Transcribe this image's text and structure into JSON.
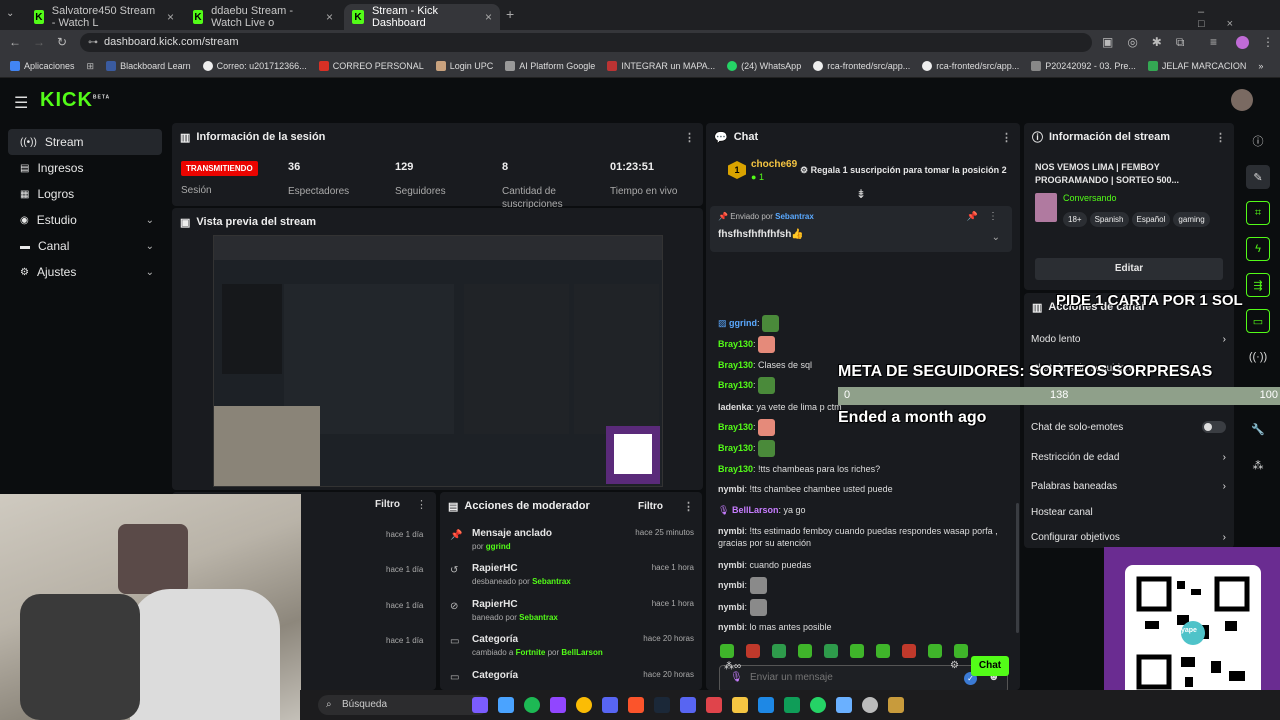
{
  "browser": {
    "tabs": [
      {
        "title": "Salvatore450 Stream - Watch L"
      },
      {
        "title": "ddaebu Stream - Watch Live o"
      },
      {
        "title": "Stream - Kick Dashboard"
      }
    ],
    "url": "dashboard.kick.com/stream",
    "bookmarks": [
      "Aplicaciones",
      "Blackboard Learn",
      "Correo: u201712366...",
      "CORREO PERSONAL",
      "Login UPC",
      "AI Platform Google",
      "INTEGRAR un MAPA...",
      "(24) WhatsApp",
      "rca-fronted/src/app...",
      "rca-fronted/src/app...",
      "P20242092 - 03. Pre...",
      "JELAF MARCACION"
    ]
  },
  "app": {
    "logo": "KICK",
    "logo_beta": "BETA",
    "nav": [
      {
        "label": "Stream",
        "icon": "stream-icon"
      },
      {
        "label": "Ingresos",
        "icon": "revenue-icon"
      },
      {
        "label": "Logros",
        "icon": "achievements-icon"
      },
      {
        "label": "Estudio",
        "icon": "studio-icon"
      },
      {
        "label": "Canal",
        "icon": "channel-icon"
      },
      {
        "label": "Ajustes",
        "icon": "settings-icon"
      }
    ],
    "session": {
      "title": "Información de la sesión",
      "status": "TRANSMITIENDO",
      "status_label": "Sesión",
      "viewers": "36",
      "viewers_label": "Espectadores",
      "followers": "129",
      "followers_label": "Seguidores",
      "subs": "8",
      "subs_label": "Cantidad de suscripciones",
      "time": "01:23:51",
      "time_label": "Tiempo en vivo"
    },
    "preview": {
      "title": "Vista previa del stream"
    },
    "left_panel": {
      "filter": "Filtro",
      "times": [
        "hace 1 día",
        "hace 1 día",
        "hace 1 día",
        "hace 1 día"
      ]
    },
    "mod_actions": {
      "title": "Acciones de moderador",
      "filter": "Filtro",
      "rows": [
        {
          "title": "Mensaje anclado",
          "sub_pre": "por",
          "user": "ggrind",
          "time": "hace 25 minutos",
          "icon": "pin-icon"
        },
        {
          "title": "RapierHC",
          "sub_pre": "desbaneado por",
          "user": "Sebantrax",
          "time": "hace 1 hora",
          "icon": "unban-icon"
        },
        {
          "title": "RapierHC",
          "sub_pre": "baneado por",
          "user": "Sebantrax",
          "time": "hace 1 hora",
          "icon": "ban-icon"
        },
        {
          "title": "Categoría",
          "sub_pre": "cambiado a",
          "target": "Fortnite",
          "sub_mid": "por",
          "user": "BellLarson",
          "time": "hace 20 horas",
          "icon": "category-icon"
        },
        {
          "title": "Categoría",
          "time": "hace 20 horas",
          "icon": "category-icon"
        }
      ]
    },
    "chat": {
      "title": "Chat",
      "gift_user": "choche69",
      "gift_count": "1",
      "gift_rank": "1",
      "gift_text": "Regala 1 suscripción para tomar la posición 2",
      "pinned_by_label": "Enviado por",
      "pinned_by": "Sebantrax",
      "pinned_text": "fhsfhsfhfhfhfsh👍",
      "messages": [
        {
          "user": "ggrind",
          "text": ":",
          "color": "#5aa9ff"
        },
        {
          "user": "Bray130",
          "text": ":",
          "color": "#53fc18"
        },
        {
          "user": "Bray130",
          "text": ": Clases de sql",
          "color": "#53fc18"
        },
        {
          "user": "Bray130",
          "text": ":",
          "color": "#53fc18"
        },
        {
          "user": "ladenka",
          "text": ": ya vete de lima p ctm",
          "color": "#ddd"
        },
        {
          "user": "Bray130",
          "text": ":",
          "color": "#53fc18"
        },
        {
          "user": "Bray130",
          "text": ":",
          "color": "#53fc18"
        },
        {
          "user": "Bray130",
          "text": ": !tts chambeas para los riches?",
          "color": "#53fc18"
        },
        {
          "user": "nymbi",
          "text": ": !tts chambee chambee usted puede",
          "color": "#ddd"
        },
        {
          "user": "BellLarson",
          "text": ": ya go",
          "color": "#c77dff"
        },
        {
          "user": "nymbi",
          "text": ": !tts estimado femboy cuando puedas respondes wasap porfa , gracias por su atención",
          "color": "#ddd"
        },
        {
          "user": "nymbi",
          "text": ": cuando puedas",
          "color": "#ddd"
        },
        {
          "user": "nymbi",
          "text": ":",
          "color": "#ddd"
        },
        {
          "user": "nymbi",
          "text": ":",
          "color": "#ddd"
        },
        {
          "user": "nymbi",
          "text": ": lo mas antes posible",
          "color": "#ddd"
        }
      ],
      "input_placeholder": "Enviar un mensaje",
      "send": "Chat"
    },
    "stream_info": {
      "title": "Información del stream",
      "stream_title": "NOS VEMOS LIMA | FEMBOY PROGRAMANDO | SORTEO 500...",
      "category": "Conversando",
      "tags": [
        "18+",
        "Spanish",
        "Español",
        "gaming"
      ],
      "edit": "Editar"
    },
    "chat_actions": {
      "title": "Acciones de canal",
      "items": [
        "Modo lento",
        "Chat de solo-seguidores",
        "",
        "Chat de solo-emotes",
        "Restricción de edad",
        "Palabras baneadas",
        "Hostear canal",
        "Configurar objetivos"
      ]
    },
    "overlay": {
      "ticker": "PIDE 1 CARTA POR 1 SOL",
      "goal_title": "META DE SEGUIDORES: SORTEOS SORPRESAS",
      "goal_min": "0",
      "goal_value": "138",
      "goal_max": "100",
      "goal_ended": "Ended a month ago"
    },
    "qr_brand": "yape"
  },
  "taskbar": {
    "search_placeholder": "Búsqueda"
  },
  "colors": {
    "accent": "#53fc18",
    "live": "#eb0400",
    "panel": "#191b1f"
  }
}
